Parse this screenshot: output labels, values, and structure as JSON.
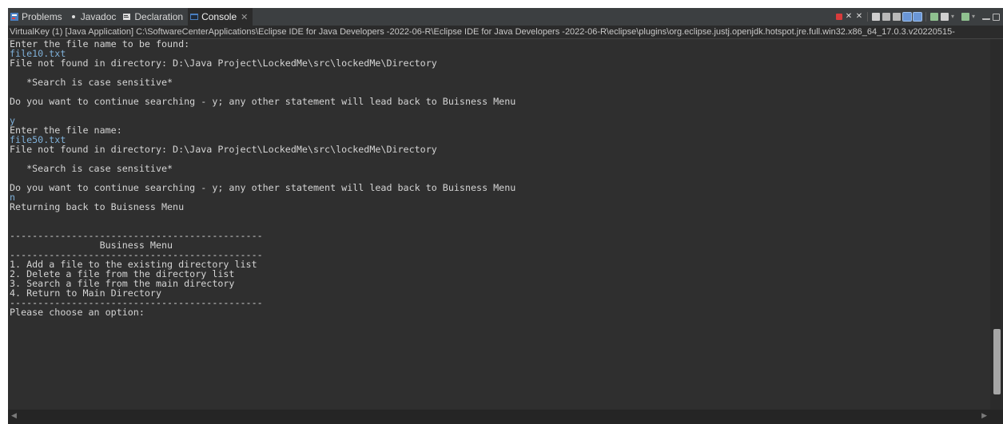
{
  "tabs": [
    {
      "label": "Problems",
      "icon": "problems-icon",
      "active": false
    },
    {
      "label": "Javadoc",
      "icon": "javadoc-icon",
      "active": false
    },
    {
      "label": "Declaration",
      "icon": "declaration-icon",
      "active": false
    },
    {
      "label": "Console",
      "icon": "console-icon",
      "active": true
    }
  ],
  "console_header": "VirtualKey (1) [Java Application] C:\\SoftwareCenterApplications\\Eclipse IDE for Java Developers -2022-06-R\\Eclipse IDE for Java Developers -2022-06-R\\eclipse\\plugins\\org.eclipse.justj.openjdk.hotspot.jre.full.win32.x86_64_17.0.3.v20220515-",
  "console_lines": [
    {
      "text": "Enter the file name to be found:",
      "type": "out"
    },
    {
      "text": "file10.txt",
      "type": "in"
    },
    {
      "text": "File not found in directory: D:\\Java Project\\LockedMe\\src\\lockedMe\\Directory",
      "type": "out"
    },
    {
      "text": "",
      "type": "out"
    },
    {
      "text": "   *Search is case sensitive*",
      "type": "out"
    },
    {
      "text": "",
      "type": "out"
    },
    {
      "text": "Do you want to continue searching - y; any other statement will lead back to Buisness Menu",
      "type": "out"
    },
    {
      "text": "",
      "type": "out"
    },
    {
      "text": "y",
      "type": "in"
    },
    {
      "text": "Enter the file name:",
      "type": "out"
    },
    {
      "text": "file50.txt",
      "type": "in"
    },
    {
      "text": "File not found in directory: D:\\Java Project\\LockedMe\\src\\lockedMe\\Directory",
      "type": "out"
    },
    {
      "text": "",
      "type": "out"
    },
    {
      "text": "   *Search is case sensitive*",
      "type": "out"
    },
    {
      "text": "",
      "type": "out"
    },
    {
      "text": "Do you want to continue searching - y; any other statement will lead back to Buisness Menu",
      "type": "out"
    },
    {
      "text": "n",
      "type": "in"
    },
    {
      "text": "Returning back to Buisness Menu",
      "type": "out"
    },
    {
      "text": "",
      "type": "out"
    },
    {
      "text": "",
      "type": "out"
    },
    {
      "text": "---------------------------------------------",
      "type": "out"
    },
    {
      "text": "                Business Menu",
      "type": "out"
    },
    {
      "text": "---------------------------------------------",
      "type": "out"
    },
    {
      "text": "1. Add a file to the existing directory list",
      "type": "out"
    },
    {
      "text": "2. Delete a file from the directory list",
      "type": "out"
    },
    {
      "text": "3. Search a file from the main directory",
      "type": "out"
    },
    {
      "text": "4. Return to Main Directory",
      "type": "out"
    },
    {
      "text": "---------------------------------------------",
      "type": "out"
    },
    {
      "text": "Please choose an option:",
      "type": "out"
    }
  ],
  "colors": {
    "background": "#2f2f2f",
    "output_text": "#d4d4d4",
    "input_text": "#7fb0d8",
    "tabbar": "#3c3f41"
  }
}
